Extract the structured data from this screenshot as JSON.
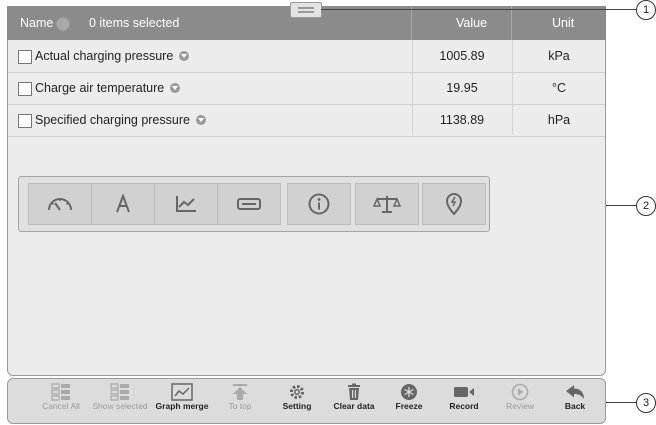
{
  "header": {
    "name_label": "Name",
    "selection_text": "0 items selected",
    "value_label": "Value",
    "unit_label": "Unit"
  },
  "rows": [
    {
      "label": "Actual charging pressure",
      "value": "1005.89",
      "unit": "kPa"
    },
    {
      "label": "Charge air temperature",
      "value": "19.95",
      "unit": "°C"
    },
    {
      "label": "Specified charging pressure",
      "value": "1138.89",
      "unit": "hPa"
    }
  ],
  "display_toolbar": {
    "icons": [
      "gauge-icon",
      "text-icon",
      "line-graph-icon",
      "digital-icon",
      "info-icon",
      "scale-icon",
      "location-pin-icon"
    ]
  },
  "bottom_toolbar": {
    "buttons": [
      {
        "label": "Cancel All",
        "icon": "cancel-all-icon",
        "enabled": false
      },
      {
        "label": "Show selected",
        "icon": "show-selected-icon",
        "enabled": false
      },
      {
        "label": "Graph merge",
        "icon": "graph-merge-icon",
        "enabled": true
      },
      {
        "label": "To top",
        "icon": "to-top-icon",
        "enabled": false
      },
      {
        "label": "Setting",
        "icon": "setting-icon",
        "enabled": true
      },
      {
        "label": "Clear data",
        "icon": "trash-icon",
        "enabled": true
      },
      {
        "label": "Freeze",
        "icon": "snowflake-icon",
        "enabled": true
      },
      {
        "label": "Record",
        "icon": "video-camera-icon",
        "enabled": true
      },
      {
        "label": "Review",
        "icon": "play-icon",
        "enabled": false
      },
      {
        "label": "Back",
        "icon": "back-arrow-icon",
        "enabled": true
      }
    ]
  },
  "callouts": [
    "1",
    "2",
    "3"
  ]
}
